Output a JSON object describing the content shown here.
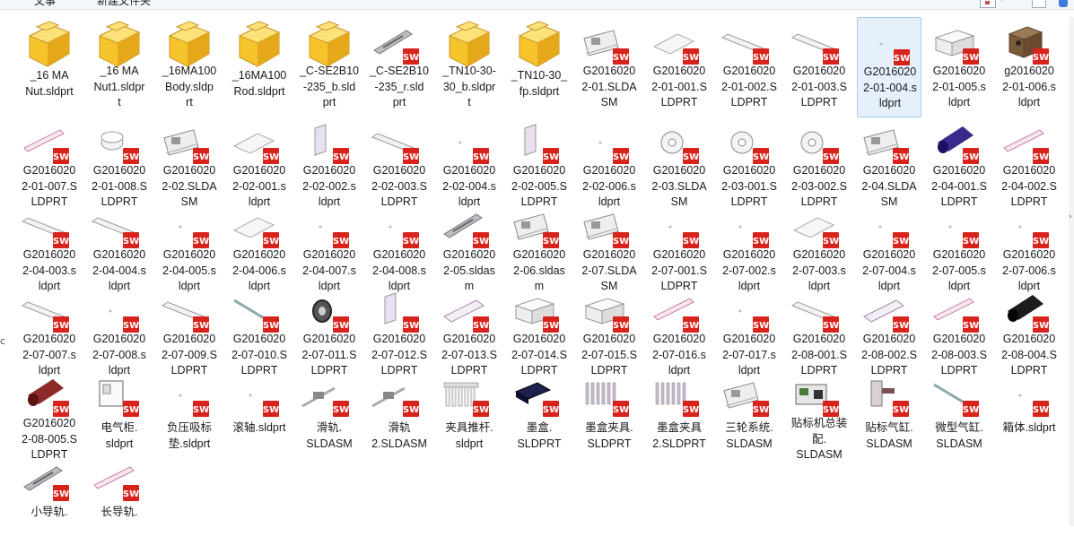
{
  "toolbar": {
    "left_label": "文事",
    "new_folder_label": "新建文件夹"
  },
  "left_edge_char": "c",
  "colors": {
    "folder": "#f5c42b",
    "sw_badge": "#d8231c",
    "selection": "#e5f0fc"
  },
  "files": [
    {
      "label": "_16 MA Nut.sldprt",
      "lines": [
        "_16 MA",
        "Nut.sldprt"
      ],
      "thumb": "folder",
      "icon": "folder-icon"
    },
    {
      "label": "_16 MA Nut1.sldprt",
      "lines": [
        "_16 MA",
        "Nut1.sldpr",
        "t"
      ],
      "thumb": "folder",
      "icon": "folder-icon"
    },
    {
      "label": "_16MA100 Body.sldprt",
      "lines": [
        "_16MA100",
        "Body.sldp",
        "rt"
      ],
      "thumb": "folder",
      "icon": "folder-icon"
    },
    {
      "label": "_16MA100 Rod.sldprt",
      "lines": [
        "_16MA100",
        "Rod.sldprt"
      ],
      "thumb": "folder",
      "icon": "folder-icon"
    },
    {
      "label": "_C-SE2B10-235_b.sldprt",
      "lines": [
        "_C-SE2B10",
        "-235_b.sld",
        "prt"
      ],
      "thumb": "folder",
      "icon": "folder-icon"
    },
    {
      "label": "_C-SE2B10-235_r.sldprt",
      "lines": [
        "_C-SE2B10",
        "-235_r.sld",
        "prt"
      ],
      "thumb": "rail",
      "icon": "rail-part-icon"
    },
    {
      "label": "_TN10-30-30_b.sldprt",
      "lines": [
        "_TN10-30-",
        "30_b.sldpr",
        "t"
      ],
      "thumb": "folder",
      "icon": "folder-icon"
    },
    {
      "label": "_TN10-30_fp.sldprt",
      "lines": [
        "_TN10-30_",
        "fp.sldprt"
      ],
      "thumb": "folder",
      "icon": "folder-icon"
    },
    {
      "label": "G20160202-01.SLDASM",
      "lines": [
        "G2016020",
        "2-01.SLDA",
        "SM"
      ],
      "thumb": "asm",
      "icon": "assembly-icon"
    },
    {
      "label": "G20160202-01-001.SLDPRT",
      "lines": [
        "G2016020",
        "2-01-001.S",
        "LDPRT"
      ],
      "thumb": "plate",
      "icon": "plate-part-icon"
    },
    {
      "label": "G20160202-01-002.SLDPRT",
      "lines": [
        "G2016020",
        "2-01-002.S",
        "LDPRT"
      ],
      "thumb": "bar",
      "icon": "bar-part-icon"
    },
    {
      "label": "G20160202-01-003.SLDPRT",
      "lines": [
        "G2016020",
        "2-01-003.S",
        "LDPRT"
      ],
      "thumb": "bar",
      "icon": "bar-part-icon"
    },
    {
      "label": "G20160202-01-004.sldprt",
      "lines": [
        "G2016020",
        "2-01-004.s",
        "ldprt"
      ],
      "thumb": "small",
      "icon": "small-part-icon",
      "selected": true
    },
    {
      "label": "G20160202-01-005.sldprt",
      "lines": [
        "G2016020",
        "2-01-005.s",
        "ldprt"
      ],
      "thumb": "box",
      "icon": "box-part-icon"
    },
    {
      "label": "g20160202-01-006.sldprt",
      "lines": [
        "g2016020",
        "2-01-006.s",
        "ldprt"
      ],
      "thumb": "brown",
      "icon": "block-part-icon"
    },
    {
      "label": "G20160202-01-007.SLDPRT",
      "lines": [
        "G2016020",
        "2-01-007.S",
        "LDPRT"
      ],
      "thumb": "pin",
      "icon": "pin-part-icon"
    },
    {
      "label": "G20160202-01-008.SLDPRT",
      "lines": [
        "G2016020",
        "2-01-008.S",
        "LDPRT"
      ],
      "thumb": "cap",
      "icon": "cap-part-icon"
    },
    {
      "label": "G20160202-02.SLDASM",
      "lines": [
        "G2016020",
        "2-02.SLDA",
        "SM"
      ],
      "thumb": "asm",
      "icon": "assembly-icon"
    },
    {
      "label": "G20160202-02-001.sldprt",
      "lines": [
        "G2016020",
        "2-02-001.s",
        "ldprt"
      ],
      "thumb": "plate",
      "icon": "plate-part-icon"
    },
    {
      "label": "G20160202-02-002.sldprt",
      "lines": [
        "G2016020",
        "2-02-002.s",
        "ldprt"
      ],
      "thumb": "panel",
      "icon": "panel-part-icon"
    },
    {
      "label": "G20160202-02-003.SLDPRT",
      "lines": [
        "G2016020",
        "2-02-003.S",
        "LDPRT"
      ],
      "thumb": "bar",
      "icon": "bar-part-icon"
    },
    {
      "label": "G20160202-02-004.sldprt",
      "lines": [
        "G2016020",
        "2-02-004.s",
        "ldprt"
      ],
      "thumb": "small",
      "icon": "small-part-icon"
    },
    {
      "label": "G20160202-02-005.SLDPRT",
      "lines": [
        "G2016020",
        "2-02-005.S",
        "LDPRT"
      ],
      "thumb": "panel",
      "icon": "panel-part-icon"
    },
    {
      "label": "G20160202-02-006.sldprt",
      "lines": [
        "G2016020",
        "2-02-006.s",
        "ldprt"
      ],
      "thumb": "small",
      "icon": "small-part-icon"
    },
    {
      "label": "G20160202-03.SLDASM",
      "lines": [
        "G2016020",
        "2-03.SLDA",
        "SM"
      ],
      "thumb": "disc",
      "icon": "disc-part-icon"
    },
    {
      "label": "G20160202-03-001.SLDPRT",
      "lines": [
        "G2016020",
        "2-03-001.S",
        "LDPRT"
      ],
      "thumb": "disc",
      "icon": "disc-part-icon"
    },
    {
      "label": "G20160202-03-002.SLDPRT",
      "lines": [
        "G2016020",
        "2-03-002.S",
        "LDPRT"
      ],
      "thumb": "disc",
      "icon": "disc-part-icon"
    },
    {
      "label": "G20160202-04.SLDASM",
      "lines": [
        "G2016020",
        "2-04.SLDA",
        "SM"
      ],
      "thumb": "asm",
      "icon": "assembly-icon"
    },
    {
      "label": "G20160202-04-001.SLDPRT",
      "lines": [
        "G2016020",
        "2-04-001.S",
        "LDPRT"
      ],
      "thumb": "purple",
      "icon": "cylinder-part-icon"
    },
    {
      "label": "G20160202-04-002.SLDPRT",
      "lines": [
        "G2016020",
        "2-04-002.S",
        "LDPRT"
      ],
      "thumb": "pin",
      "icon": "pin-part-icon"
    },
    {
      "label": "G20160202-04-003.sldprt",
      "lines": [
        "G2016020",
        "2-04-003.s",
        "ldprt"
      ],
      "thumb": "bar",
      "icon": "bar-part-icon"
    },
    {
      "label": "G20160202-04-004.sldprt",
      "lines": [
        "G2016020",
        "2-04-004.s",
        "ldprt"
      ],
      "thumb": "bar",
      "icon": "bar-part-icon"
    },
    {
      "label": "G20160202-04-005.sldprt",
      "lines": [
        "G2016020",
        "2-04-005.s",
        "ldprt"
      ],
      "thumb": "small",
      "icon": "small-part-icon"
    },
    {
      "label": "G20160202-04-006.sldprt",
      "lines": [
        "G2016020",
        "2-04-006.s",
        "ldprt"
      ],
      "thumb": "plate",
      "icon": "plate-part-icon"
    },
    {
      "label": "G20160202-04-007.sldprt",
      "lines": [
        "G2016020",
        "2-04-007.s",
        "ldprt"
      ],
      "thumb": "small",
      "icon": "small-part-icon"
    },
    {
      "label": "G20160202-04-008.sldprt",
      "lines": [
        "G2016020",
        "2-04-008.s",
        "ldprt"
      ],
      "thumb": "small",
      "icon": "small-part-icon"
    },
    {
      "label": "G20160202-05.sldasm",
      "lines": [
        "G2016020",
        "2-05.sldas",
        "m"
      ],
      "thumb": "rail",
      "icon": "rail-part-icon"
    },
    {
      "label": "G20160202-06.sldasm",
      "lines": [
        "G2016020",
        "2-06.sldas",
        "m"
      ],
      "thumb": "asm",
      "icon": "assembly-icon"
    },
    {
      "label": "G20160202-07.SLDASM",
      "lines": [
        "G2016020",
        "2-07.SLDA",
        "SM"
      ],
      "thumb": "asm",
      "icon": "assembly-icon"
    },
    {
      "label": "G20160202-07-001.SLDPRT",
      "lines": [
        "G2016020",
        "2-07-001.S",
        "LDPRT"
      ],
      "thumb": "small",
      "icon": "small-part-icon"
    },
    {
      "label": "G20160202-07-002.sldprt",
      "lines": [
        "G2016020",
        "2-07-002.s",
        "ldprt"
      ],
      "thumb": "small",
      "icon": "small-part-icon"
    },
    {
      "label": "G20160202-07-003.sldprt",
      "lines": [
        "G2016020",
        "2-07-003.s",
        "ldprt"
      ],
      "thumb": "plate",
      "icon": "plate-part-icon"
    },
    {
      "label": "G20160202-07-004.sldprt",
      "lines": [
        "G2016020",
        "2-07-004.s",
        "ldprt"
      ],
      "thumb": "small",
      "icon": "small-part-icon"
    },
    {
      "label": "G20160202-07-005.sldprt",
      "lines": [
        "G2016020",
        "2-07-005.s",
        "ldprt"
      ],
      "thumb": "small",
      "icon": "small-part-icon"
    },
    {
      "label": "G20160202-07-006.sldprt",
      "lines": [
        "G2016020",
        "2-07-006.s",
        "ldprt"
      ],
      "thumb": "small",
      "icon": "small-part-icon"
    },
    {
      "label": "G20160202-07-007.sldprt",
      "lines": [
        "G2016020",
        "2-07-007.s",
        "ldprt"
      ],
      "thumb": "bar",
      "icon": "bar-part-icon"
    },
    {
      "label": "G20160202-07-008.sldprt",
      "lines": [
        "G2016020",
        "2-07-008.s",
        "ldprt"
      ],
      "thumb": "small",
      "icon": "small-part-icon"
    },
    {
      "label": "G20160202-07-009.SLDPRT",
      "lines": [
        "G2016020",
        "2-07-009.S",
        "LDPRT"
      ],
      "thumb": "bar",
      "icon": "bar-part-icon"
    },
    {
      "label": "G20160202-07-010.SLDPRT",
      "lines": [
        "G2016020",
        "2-07-010.S",
        "LDPRT"
      ],
      "thumb": "shaft",
      "icon": "shaft-part-icon"
    },
    {
      "label": "G20160202-07-011.SLDPRT",
      "lines": [
        "G2016020",
        "2-07-011.S",
        "LDPRT"
      ],
      "thumb": "gear",
      "icon": "gear-part-icon"
    },
    {
      "label": "G20160202-07-012.SLDPRT",
      "lines": [
        "G2016020",
        "2-07-012.S",
        "LDPRT"
      ],
      "thumb": "panel",
      "icon": "panel-part-icon"
    },
    {
      "label": "G20160202-07-013.SLDPRT",
      "lines": [
        "G2016020",
        "2-07-013.S",
        "LDPRT"
      ],
      "thumb": "roller",
      "icon": "roller-part-icon"
    },
    {
      "label": "G20160202-07-014.SLDPRT",
      "lines": [
        "G2016020",
        "2-07-014.S",
        "LDPRT"
      ],
      "thumb": "box",
      "icon": "box-part-icon"
    },
    {
      "label": "G20160202-07-015.SLDPRT",
      "lines": [
        "G2016020",
        "2-07-015.S",
        "LDPRT"
      ],
      "thumb": "box",
      "icon": "box-part-icon"
    },
    {
      "label": "G20160202-07-016.sldprt",
      "lines": [
        "G2016020",
        "2-07-016.s",
        "ldprt"
      ],
      "thumb": "pin",
      "icon": "pin-part-icon"
    },
    {
      "label": "G20160202-07-017.sldprt",
      "lines": [
        "G2016020",
        "2-07-017.s",
        "ldprt"
      ],
      "thumb": "small",
      "icon": "small-part-icon"
    },
    {
      "label": "G20160202-08-001.SLDPRT",
      "lines": [
        "G2016020",
        "2-08-001.S",
        "LDPRT"
      ],
      "thumb": "bar",
      "icon": "bar-part-icon"
    },
    {
      "label": "G20160202-08-002.SLDPRT",
      "lines": [
        "G2016020",
        "2-08-002.S",
        "LDPRT"
      ],
      "thumb": "roller",
      "icon": "roller-part-icon"
    },
    {
      "label": "G20160202-08-003.SLDPRT",
      "lines": [
        "G2016020",
        "2-08-003.S",
        "LDPRT"
      ],
      "thumb": "pin",
      "icon": "pin-part-icon"
    },
    {
      "label": "G20160202-08-004.SLDPRT",
      "lines": [
        "G2016020",
        "2-08-004.S",
        "LDPRT"
      ],
      "thumb": "black",
      "icon": "cylinder-part-icon"
    },
    {
      "label": "G20160202-08-005.SLDPRT",
      "lines": [
        "G2016020",
        "2-08-005.S",
        "LDPRT"
      ],
      "thumb": "red",
      "icon": "cylinder-part-icon"
    },
    {
      "label": "电气柜.sldprt",
      "lines": [
        "电气柜.",
        "sldprt"
      ],
      "thumb": "cabinet",
      "icon": "cabinet-part-icon"
    },
    {
      "label": "负压吸标垫.sldprt",
      "lines": [
        "负压吸标",
        "垫.sldprt"
      ],
      "thumb": "small",
      "icon": "small-part-icon"
    },
    {
      "label": "滚轴.sldprt",
      "lines": [
        "滚轴.sldprt"
      ],
      "thumb": "small",
      "icon": "small-part-icon"
    },
    {
      "label": "滑轨.SLDASM",
      "lines": [
        "滑轨.",
        "SLDASM"
      ],
      "thumb": "slide",
      "icon": "slide-rail-icon"
    },
    {
      "label": "滑轨2.SLDASM",
      "lines": [
        "滑轨",
        "2.SLDASM"
      ],
      "thumb": "slide",
      "icon": "slide-rail-icon"
    },
    {
      "label": "夹具推杆.sldprt",
      "lines": [
        "夹具推杆.",
        "sldprt"
      ],
      "thumb": "comb",
      "icon": "pusher-part-icon"
    },
    {
      "label": "墨盒.SLDPRT",
      "lines": [
        "墨盒.",
        "SLDPRT"
      ],
      "thumb": "ink",
      "icon": "ink-cartridge-icon"
    },
    {
      "label": "墨盒夹具.SLDPRT",
      "lines": [
        "墨盒夹具.",
        "SLDPRT"
      ],
      "thumb": "fins",
      "icon": "fixture-part-icon"
    },
    {
      "label": "墨盒夹具2.SLDPRT",
      "lines": [
        "墨盒夹具",
        "2.SLDPRT"
      ],
      "thumb": "fins",
      "icon": "fixture-part-icon"
    },
    {
      "label": "三轮系统.SLDASM",
      "lines": [
        "三轮系统.",
        "SLDASM"
      ],
      "thumb": "asm",
      "icon": "assembly-icon"
    },
    {
      "label": "贴标机总装配.SLDASM",
      "lines": [
        "贴标机总装",
        "配.",
        "SLDASM"
      ],
      "thumb": "machine",
      "icon": "machine-assembly-icon"
    },
    {
      "label": "贴标气缸.SLDASM",
      "lines": [
        "贴标气缸.",
        "SLDASM"
      ],
      "thumb": "cyl",
      "icon": "cylinder-assembly-icon"
    },
    {
      "label": "微型气缸.SLDASM",
      "lines": [
        "微型气缸.",
        "SLDASM"
      ],
      "thumb": "shaft",
      "icon": "cylinder-assembly-icon"
    },
    {
      "label": "箱体.sldprt",
      "lines": [
        "箱体.sldprt"
      ],
      "thumb": "small",
      "icon": "small-part-icon"
    },
    {
      "label": "小导轨.",
      "lines": [
        "小导轨."
      ],
      "thumb": "rail",
      "icon": "rail-part-icon"
    },
    {
      "label": "长导轨.",
      "lines": [
        "长导轨."
      ],
      "thumb": "pin",
      "icon": "rail-part-icon"
    }
  ]
}
